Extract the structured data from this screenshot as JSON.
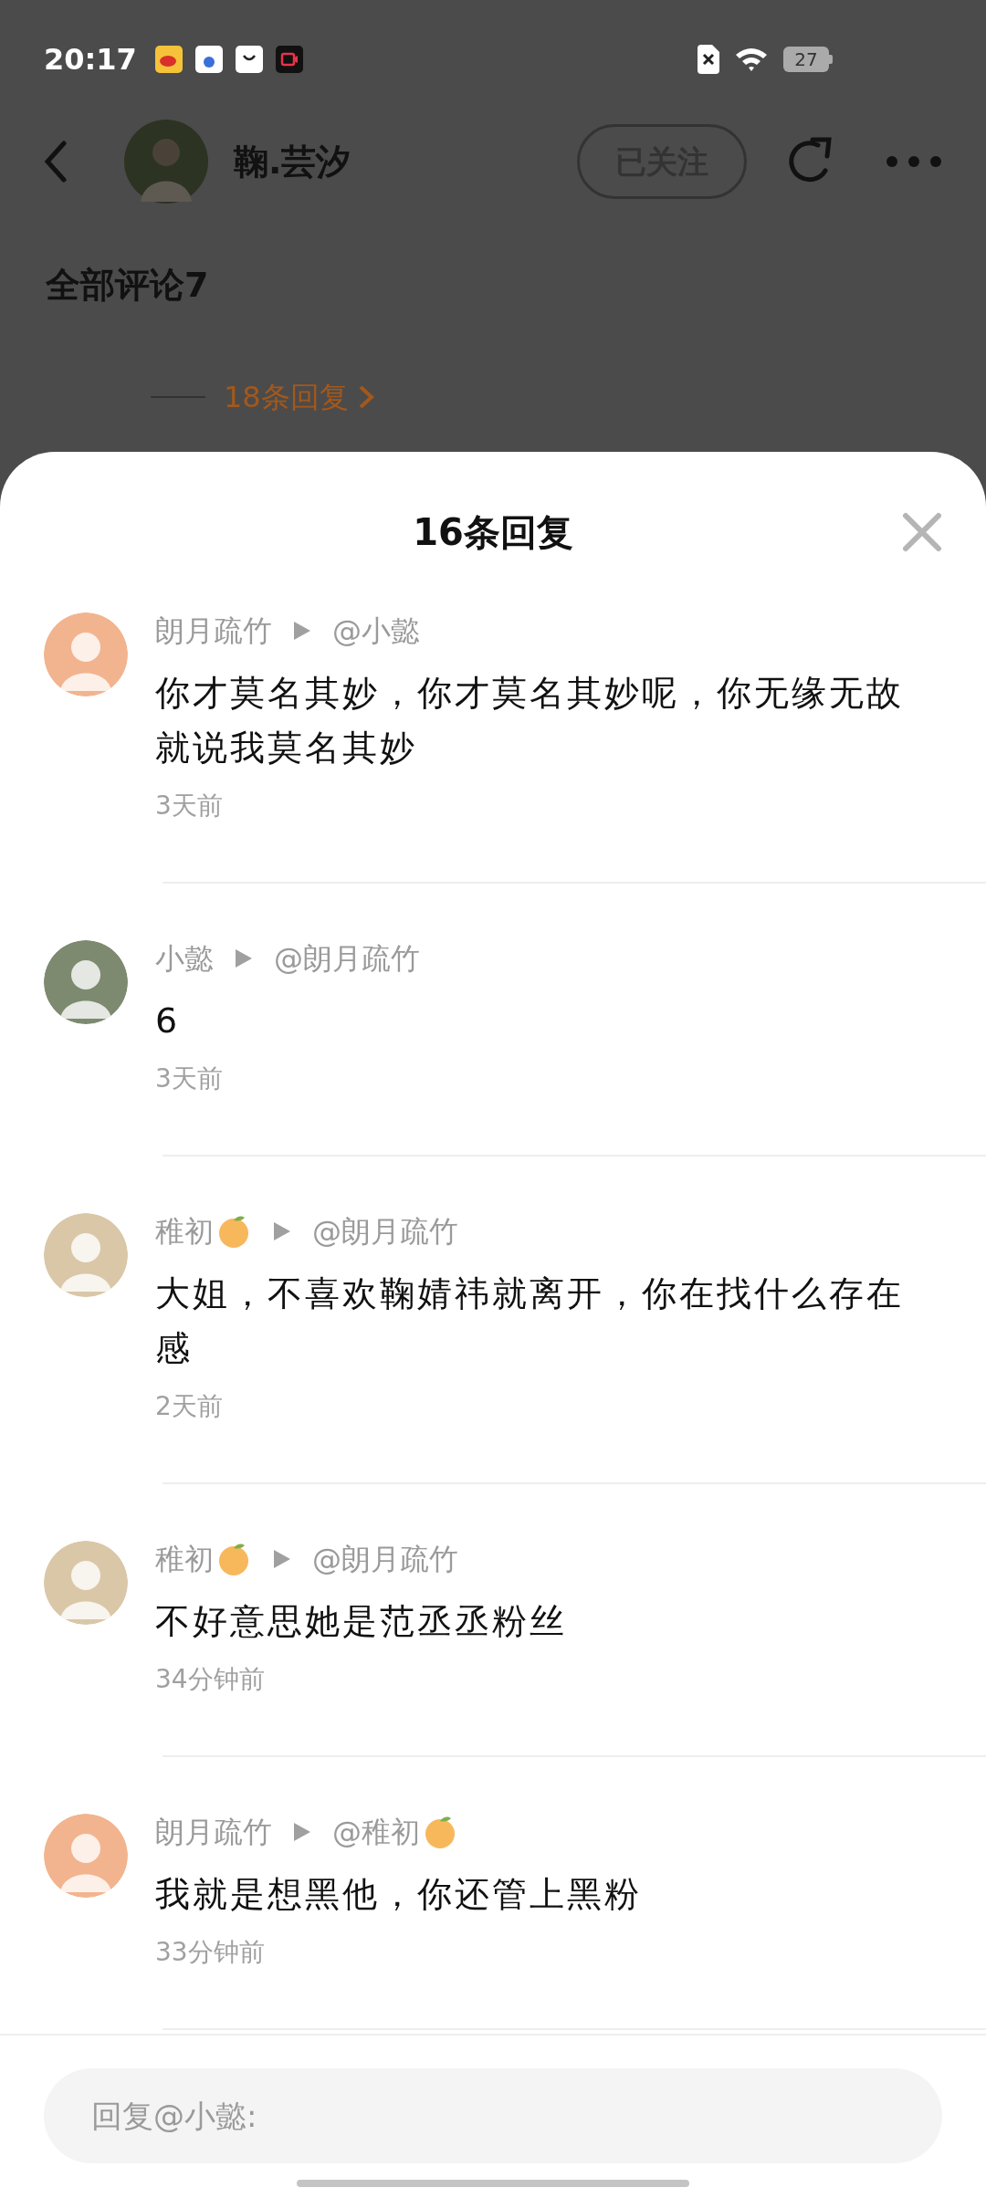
{
  "status_bar": {
    "time": "20:17",
    "battery": "27"
  },
  "header": {
    "user_name": "鞠.芸汐",
    "follow_button": "已关注"
  },
  "section_title": "全部评论7",
  "reply_link": "18条回复",
  "sheet": {
    "title": "16条回复",
    "comments": [
      {
        "author": "朗月疏竹",
        "author_orange": false,
        "target": "@小懿",
        "target_orange": false,
        "text": "你才莫名其妙，你才莫名其妙呢，你无缘无故就说我莫名其妙",
        "time": "3天前",
        "color": "#f2b48e"
      },
      {
        "author": "小懿",
        "author_orange": false,
        "target": "@朗月疏竹",
        "target_orange": false,
        "text": "6",
        "time": "3天前",
        "color": "#7d8a70"
      },
      {
        "author": "稚初",
        "author_orange": true,
        "target": "@朗月疏竹",
        "target_orange": false,
        "text": "大姐，不喜欢鞠婧祎就离开，你在找什么存在感",
        "time": "2天前",
        "color": "#d9c7a8"
      },
      {
        "author": "稚初",
        "author_orange": true,
        "target": "@朗月疏竹",
        "target_orange": false,
        "text": "不好意思她是范丞丞粉丝",
        "time": "34分钟前",
        "color": "#d9c7a8"
      },
      {
        "author": "朗月疏竹",
        "author_orange": false,
        "target": "@稚初",
        "target_orange": true,
        "text": "我就是想黑他，你还管上黑粉",
        "time": "33分钟前",
        "color": "#f2b48e"
      }
    ]
  },
  "reply_input": {
    "placeholder": "回复@小懿:"
  }
}
